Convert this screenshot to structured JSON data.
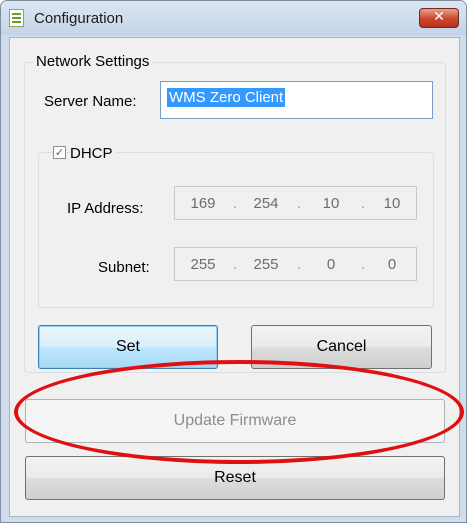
{
  "window": {
    "title": "Configuration",
    "close_glyph": "✕"
  },
  "network": {
    "group_title": "Network Settings",
    "server_label": "Server Name:",
    "server_value": "WMS Zero Client",
    "dhcp_label": "DHCP",
    "dhcp_checked": true,
    "check_glyph": "✓",
    "ip_label": "IP Address:",
    "ip": [
      "169",
      "254",
      "10",
      "10"
    ],
    "subnet_label": "Subnet:",
    "subnet": [
      "255",
      "255",
      "0",
      "0"
    ],
    "dot": "."
  },
  "buttons": {
    "set": "Set",
    "cancel": "Cancel",
    "update_firmware": "Update Firmware",
    "reset": "Reset"
  },
  "annotation": {
    "highlight_color": "#e01010"
  }
}
